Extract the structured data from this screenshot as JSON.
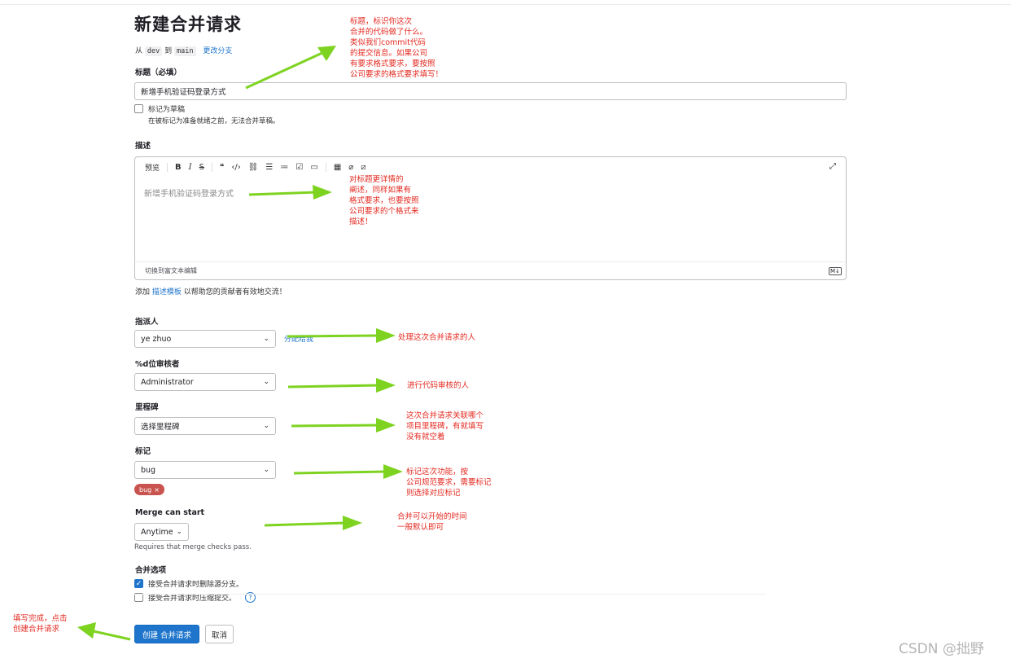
{
  "page": {
    "title": "新建合并请求",
    "branch_from_prefix": "从",
    "source_branch": "dev",
    "branch_to": "到",
    "target_branch": "main",
    "change_branch": "更改分支"
  },
  "title_field": {
    "label": "标题（必填）",
    "value": "新增手机验证码登录方式"
  },
  "draft": {
    "label": "标记为草稿",
    "help": "在被标记为准备就绪之前，无法合并草稿。"
  },
  "description": {
    "label": "描述",
    "toolbar": {
      "preview": "预览",
      "bold": "B",
      "italic": "I",
      "strike": "S",
      "icons": [
        "quote-icon",
        "code-icon",
        "link-icon",
        "bullet-list-icon",
        "numbered-list-icon",
        "task-list-icon",
        "collapsible-icon",
        "table-icon",
        "attachment-icon",
        "slash-command-icon",
        "fullscreen-icon"
      ]
    },
    "content": "新增手机验证码登录方式",
    "switch_rich_text": "切换到富文本编辑",
    "markdown_badge": "M↓",
    "template_prefix": "添加",
    "template_link": "描述模板",
    "template_suffix": "以帮助您的贡献者有效地交流！"
  },
  "assignee": {
    "label": "指派人",
    "value": "ye zhuo",
    "assign_me": "分配给我"
  },
  "reviewer": {
    "label": "%d位审核者",
    "value": "Administrator"
  },
  "milestone": {
    "label": "里程碑",
    "value": "选择里程碑"
  },
  "labels": {
    "label": "标记",
    "value": "bug",
    "tag": "bug",
    "tag_close": "×",
    "tag_color": "#c9534e"
  },
  "merge_start": {
    "label": "Merge can start",
    "value": "Anytime",
    "hint": "Requires that merge checks pass."
  },
  "merge_options": {
    "label": "合并选项",
    "delete_source": "接受合并请求时删除源分支。",
    "squash": "接受合并请求时压缩提交。",
    "help_icon": "?"
  },
  "actions": {
    "create": "创建 合并请求",
    "cancel": "取消"
  },
  "annotations": {
    "title_note": "标题，标识你这次\n合并的代码做了什么。\n类似我们commit代码\n的提交信息。如果公司\n有要求格式要求，要按照\n公司要求的格式要求填写！",
    "description_note": "对标题更详情的\n阐述，同样如果有\n格式要求，也要按照\n公司要求的个格式来\n描述！",
    "assignee_note": "处理这次合并请求的人",
    "reviewer_note": "进行代码审核的人",
    "milestone_note": "这次合并请求关联哪个\n项目里程碑，有就填写\n没有就空着",
    "label_note": "标记这次功能，按\n公司规范要求，需要标记\n则选择对应标记",
    "merge_start_note": "合并可以开始的时间\n一般默认即可",
    "submit_note": "填写完成，点击\n创建合并请求"
  },
  "watermark": "CSDN @拙野",
  "colors": {
    "primary": "#1f75cb",
    "note_red": "#e32a21",
    "arrow_green": "#7ed321"
  }
}
